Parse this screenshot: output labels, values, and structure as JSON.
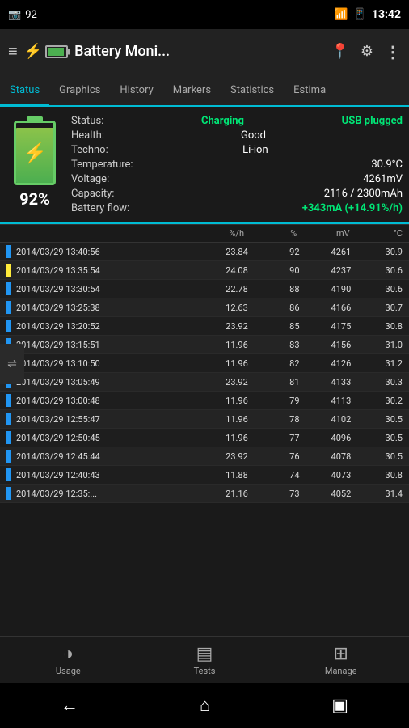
{
  "statusBar": {
    "leftIcons": [
      "📷",
      "92"
    ],
    "time": "13:42",
    "rightIcons": [
      "wifi",
      "signal",
      "battery"
    ]
  },
  "appBar": {
    "title": "Battery Moni...",
    "menuIcon": "≡"
  },
  "tabs": [
    {
      "id": "status",
      "label": "Status",
      "active": true
    },
    {
      "id": "graphics",
      "label": "Graphics",
      "active": false
    },
    {
      "id": "history",
      "label": "History",
      "active": false
    },
    {
      "id": "markers",
      "label": "Markers",
      "active": false
    },
    {
      "id": "statistics",
      "label": "Statistics",
      "active": false
    },
    {
      "id": "estima",
      "label": "Estima",
      "active": false
    }
  ],
  "statusPanel": {
    "batteryPercent": "92%",
    "statusLabel": "Status:",
    "statusValue": "Charging",
    "usbLabel": "USB plugged",
    "healthLabel": "Health:",
    "healthValue": "Good",
    "technoLabel": "Techno:",
    "technoValue": "Li-ion",
    "tempLabel": "Temperature:",
    "tempValue": "30.9°C",
    "voltageLabel": "Voltage:",
    "voltageValue": "4261mV",
    "capacityLabel": "Capacity:",
    "capacityValue": "2116 / 2300mAh",
    "flowLabel": "Battery flow:",
    "flowValue": "+343mA (+14.91%/h)"
  },
  "tableHeaders": {
    "datetime": "",
    "rate": "%/h",
    "percent": "%",
    "mv": "mV",
    "temp": "°C"
  },
  "tableRows": [
    {
      "datetime": "2014/03/29  13:40:56",
      "rate": "23.84",
      "percent": "92",
      "mv": "4261",
      "temp": "30.9",
      "color": "blue"
    },
    {
      "datetime": "2014/03/29  13:35:54",
      "rate": "24.08",
      "percent": "90",
      "mv": "4237",
      "temp": "30.6",
      "color": "yellow"
    },
    {
      "datetime": "2014/03/29  13:30:54",
      "rate": "22.78",
      "percent": "88",
      "mv": "4190",
      "temp": "30.6",
      "color": "blue"
    },
    {
      "datetime": "2014/03/29  13:25:38",
      "rate": "12.63",
      "percent": "86",
      "mv": "4166",
      "temp": "30.7",
      "color": "blue"
    },
    {
      "datetime": "2014/03/29  13:20:52",
      "rate": "23.92",
      "percent": "85",
      "mv": "4175",
      "temp": "30.8",
      "color": "blue"
    },
    {
      "datetime": "2014/03/29  13:15:51",
      "rate": "11.96",
      "percent": "83",
      "mv": "4156",
      "temp": "31.0",
      "color": "blue"
    },
    {
      "datetime": "2014/03/29  13:10:50",
      "rate": "11.96",
      "percent": "82",
      "mv": "4126",
      "temp": "31.2",
      "color": "blue"
    },
    {
      "datetime": "2014/03/29  13:05:49",
      "rate": "23.92",
      "percent": "81",
      "mv": "4133",
      "temp": "30.3",
      "color": "blue"
    },
    {
      "datetime": "2014/03/29  13:00:48",
      "rate": "11.96",
      "percent": "79",
      "mv": "4113",
      "temp": "30.2",
      "color": "blue"
    },
    {
      "datetime": "2014/03/29  12:55:47",
      "rate": "11.96",
      "percent": "78",
      "mv": "4102",
      "temp": "30.5",
      "color": "blue"
    },
    {
      "datetime": "2014/03/29  12:50:45",
      "rate": "11.96",
      "percent": "77",
      "mv": "4096",
      "temp": "30.5",
      "color": "blue"
    },
    {
      "datetime": "2014/03/29  12:45:44",
      "rate": "23.92",
      "percent": "76",
      "mv": "4078",
      "temp": "30.5",
      "color": "blue"
    },
    {
      "datetime": "2014/03/29  12:40:43",
      "rate": "11.88",
      "percent": "74",
      "mv": "4073",
      "temp": "30.8",
      "color": "blue"
    },
    {
      "datetime": "2014/03/29  12:35:...",
      "rate": "21.16",
      "percent": "73",
      "mv": "4052",
      "temp": "31.4",
      "color": "blue"
    }
  ],
  "bottomNav": [
    {
      "id": "usage",
      "label": "Usage",
      "icon": "pie"
    },
    {
      "id": "tests",
      "label": "Tests",
      "icon": "table"
    },
    {
      "id": "manage",
      "label": "Manage",
      "icon": "grid"
    }
  ],
  "systemNav": {
    "back": "←",
    "home": "⌂",
    "recents": "▣"
  }
}
